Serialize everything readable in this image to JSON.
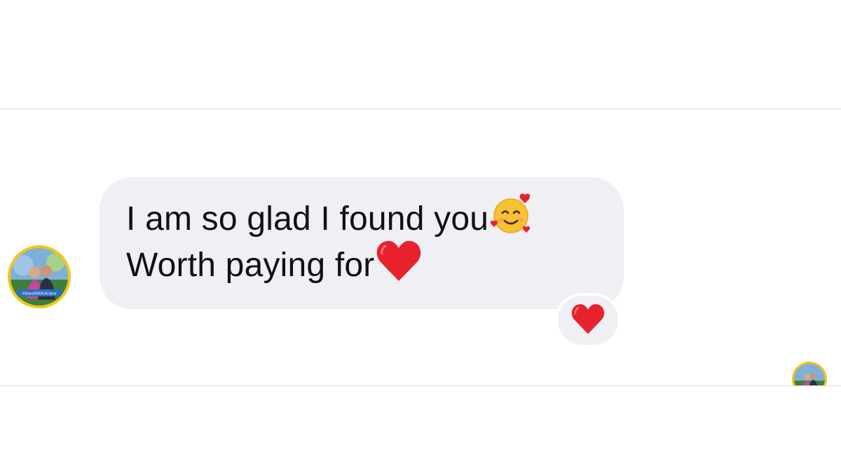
{
  "conversation": {
    "message": {
      "lines": [
        {
          "text": "I am so glad I found you",
          "emoji": "smiling-face-with-hearts-icon"
        },
        {
          "text": "Worth paying for",
          "emoji": "red-heart-icon"
        }
      ]
    },
    "reaction": {
      "emoji": "red-heart-icon"
    },
    "sender_avatar": {
      "badge_text": "#StandWithUkraine"
    }
  },
  "colors": {
    "bubble": "#efeff4",
    "avatar_ring": "#f2c617",
    "heart": "#e8222d",
    "text": "#111111"
  }
}
